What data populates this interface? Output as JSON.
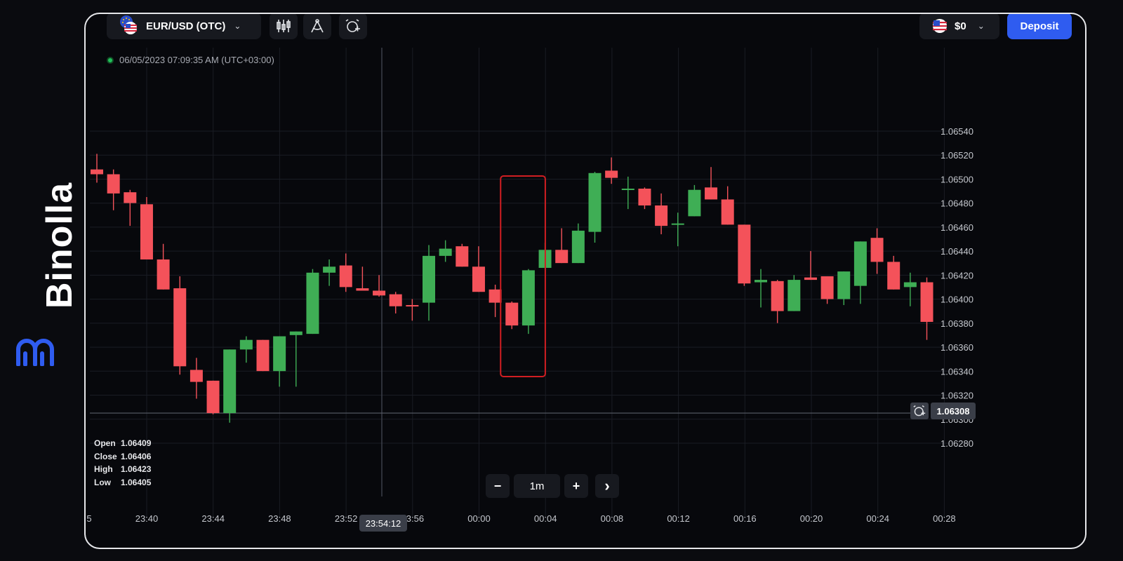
{
  "brand": {
    "name": "Binolla",
    "accent": "#2f5cf0"
  },
  "header": {
    "pair_label": "EUR/USD (OTC)",
    "pair_icon": "eu-us-flag-icon",
    "tools": [
      "candlestick-chart-icon",
      "drawing-tools-icon",
      "add-alert-icon"
    ],
    "account_label": "$0",
    "account_icon": "us-flag-icon",
    "deposit_label": "Deposit"
  },
  "timestamp": "06/05/2023 07:09:35 AM  (UTC+03:00)",
  "ohlc": {
    "open_label": "Open",
    "open": "1.06409",
    "close_label": "Close",
    "close": "1.06406",
    "high_label": "High",
    "high": "1.06423",
    "low_label": "Low",
    "low": "1.06405"
  },
  "zoom": {
    "minus": "−",
    "interval": "1m",
    "plus": "+",
    "next": "›"
  },
  "crosshair_time": "23:54:12",
  "current_price": "1.06308",
  "colors": {
    "up": "#3fae55",
    "down": "#f4525a",
    "highlight": "#d01e22",
    "grid": "#1a1c24"
  },
  "chart_data": {
    "type": "candlestick",
    "y_ticks": [
      "1.06540",
      "1.06520",
      "1.06500",
      "1.06480",
      "1.06460",
      "1.06440",
      "1.06420",
      "1.06400",
      "1.06380",
      "1.06360",
      "1.06340",
      "1.06320",
      "1.06300",
      "1.06280"
    ],
    "ylim": [
      1.0627,
      1.0656
    ],
    "x_ticks": [
      "5",
      "23:40",
      "23:44",
      "23:48",
      "23:52",
      "23:56",
      "00:00",
      "00:04",
      "00:08",
      "00:12",
      "00:16",
      "00:20",
      "00:24",
      "00:28"
    ],
    "candles": [
      {
        "o": 1.06511,
        "c": 1.06507,
        "h": 1.06524,
        "l": 1.065
      },
      {
        "o": 1.06507,
        "c": 1.06491,
        "h": 1.06511,
        "l": 1.06477
      },
      {
        "o": 1.06492,
        "c": 1.06483,
        "h": 1.06494,
        "l": 1.06464
      },
      {
        "o": 1.06482,
        "c": 1.06436,
        "h": 1.06488,
        "l": 1.06436
      },
      {
        "o": 1.06436,
        "c": 1.06411,
        "h": 1.06449,
        "l": 1.06411
      },
      {
        "o": 1.06412,
        "c": 1.06347,
        "h": 1.06422,
        "l": 1.0634
      },
      {
        "o": 1.06344,
        "c": 1.06334,
        "h": 1.06354,
        "l": 1.0632
      },
      {
        "o": 1.06335,
        "c": 1.06308,
        "h": 1.06335,
        "l": 1.06307
      },
      {
        "o": 1.06308,
        "c": 1.06361,
        "h": 1.06361,
        "l": 1.063
      },
      {
        "o": 1.06361,
        "c": 1.06369,
        "h": 1.06372,
        "l": 1.0635
      },
      {
        "o": 1.06369,
        "c": 1.06343,
        "h": 1.06369,
        "l": 1.06343
      },
      {
        "o": 1.06343,
        "c": 1.06372,
        "h": 1.06372,
        "l": 1.0633
      },
      {
        "o": 1.06373,
        "c": 1.06376,
        "h": 1.06376,
        "l": 1.0633
      },
      {
        "o": 1.06374,
        "c": 1.06425,
        "h": 1.06428,
        "l": 1.06374
      },
      {
        "o": 1.06425,
        "c": 1.0643,
        "h": 1.06436,
        "l": 1.06414
      },
      {
        "o": 1.06431,
        "c": 1.06413,
        "h": 1.06441,
        "l": 1.06409
      },
      {
        "o": 1.06412,
        "c": 1.0641,
        "h": 1.0643,
        "l": 1.0641
      },
      {
        "o": 1.0641,
        "c": 1.06406,
        "h": 1.06423,
        "l": 1.06405
      },
      {
        "o": 1.06407,
        "c": 1.06397,
        "h": 1.06409,
        "l": 1.06391
      },
      {
        "o": 1.06398,
        "c": 1.06397,
        "h": 1.06403,
        "l": 1.06385
      },
      {
        "o": 1.064,
        "c": 1.06439,
        "h": 1.06448,
        "l": 1.06385
      },
      {
        "o": 1.06439,
        "c": 1.06445,
        "h": 1.06452,
        "l": 1.06434
      },
      {
        "o": 1.06447,
        "c": 1.0643,
        "h": 1.06449,
        "l": 1.0643
      },
      {
        "o": 1.0643,
        "c": 1.06409,
        "h": 1.06447,
        "l": 1.06409
      },
      {
        "o": 1.06411,
        "c": 1.064,
        "h": 1.06415,
        "l": 1.06388
      },
      {
        "o": 1.064,
        "c": 1.06381,
        "h": 1.06401,
        "l": 1.06378
      },
      {
        "o": 1.06381,
        "c": 1.06427,
        "h": 1.06428,
        "l": 1.06374
      },
      {
        "o": 1.06429,
        "c": 1.06444,
        "h": 1.0645,
        "l": 1.06429
      },
      {
        "o": 1.06444,
        "c": 1.06433,
        "h": 1.06462,
        "l": 1.06433
      },
      {
        "o": 1.06433,
        "c": 1.0646,
        "h": 1.06466,
        "l": 1.06433
      },
      {
        "o": 1.06459,
        "c": 1.06508,
        "h": 1.06509,
        "l": 1.0645
      },
      {
        "o": 1.0651,
        "c": 1.06504,
        "h": 1.06521,
        "l": 1.06499
      },
      {
        "o": 1.06495,
        "c": 1.06495,
        "h": 1.06505,
        "l": 1.06478
      },
      {
        "o": 1.06495,
        "c": 1.06481,
        "h": 1.06496,
        "l": 1.06478
      },
      {
        "o": 1.06481,
        "c": 1.06464,
        "h": 1.06491,
        "l": 1.06457
      },
      {
        "o": 1.06465,
        "c": 1.06466,
        "h": 1.06475,
        "l": 1.06447
      },
      {
        "o": 1.06472,
        "c": 1.06494,
        "h": 1.06498,
        "l": 1.06472
      },
      {
        "o": 1.06496,
        "c": 1.06486,
        "h": 1.06513,
        "l": 1.06486
      },
      {
        "o": 1.06486,
        "c": 1.06465,
        "h": 1.06497,
        "l": 1.06465
      },
      {
        "o": 1.06465,
        "c": 1.06416,
        "h": 1.06465,
        "l": 1.06414
      },
      {
        "o": 1.06417,
        "c": 1.06419,
        "h": 1.06428,
        "l": 1.06396
      },
      {
        "o": 1.06418,
        "c": 1.06393,
        "h": 1.06419,
        "l": 1.06383
      },
      {
        "o": 1.06393,
        "c": 1.06419,
        "h": 1.06423,
        "l": 1.06393
      },
      {
        "o": 1.06421,
        "c": 1.06419,
        "h": 1.06443,
        "l": 1.06419
      },
      {
        "o": 1.06422,
        "c": 1.06403,
        "h": 1.06422,
        "l": 1.06399
      },
      {
        "o": 1.06403,
        "c": 1.06426,
        "h": 1.06426,
        "l": 1.06398
      },
      {
        "o": 1.06414,
        "c": 1.06451,
        "h": 1.06451,
        "l": 1.06399
      },
      {
        "o": 1.06454,
        "c": 1.06434,
        "h": 1.06462,
        "l": 1.06424
      },
      {
        "o": 1.06434,
        "c": 1.06411,
        "h": 1.06439,
        "l": 1.06411
      },
      {
        "o": 1.06413,
        "c": 1.06417,
        "h": 1.06425,
        "l": 1.06397
      },
      {
        "o": 1.06417,
        "c": 1.06384,
        "h": 1.06421,
        "l": 1.06369
      }
    ],
    "highlight_range": [
      25,
      26
    ],
    "price_line": 1.06308,
    "crosshair_time": "23:54:12"
  }
}
